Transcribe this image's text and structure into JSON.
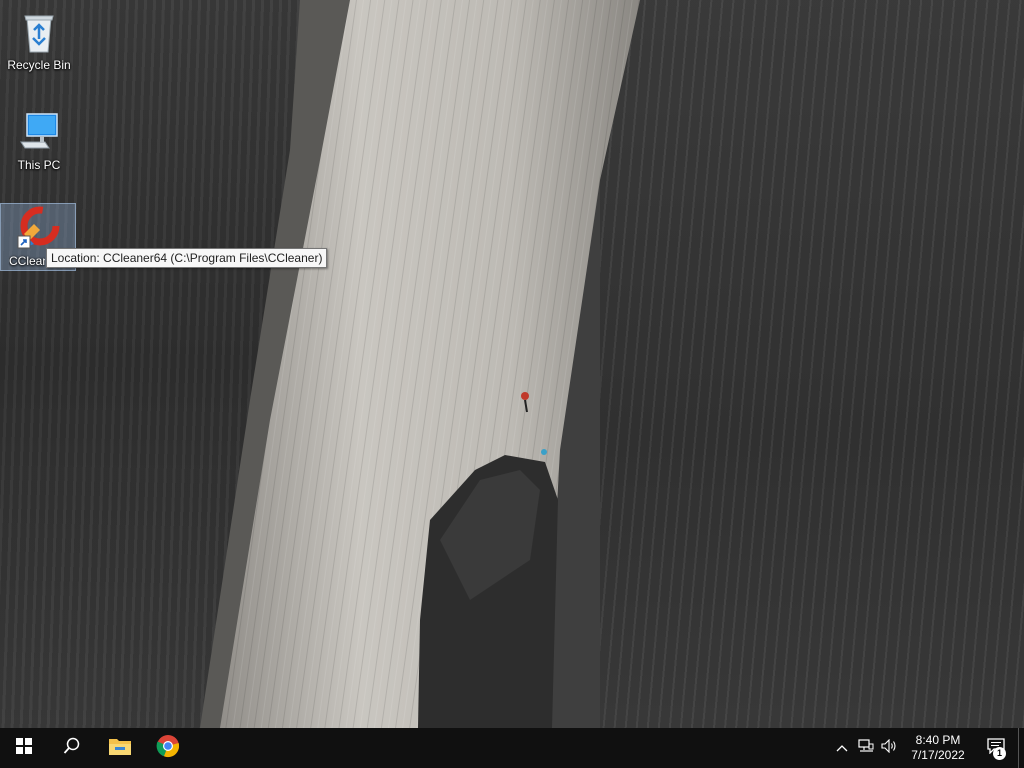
{
  "desktop": {
    "icons": [
      {
        "label": "Recycle Bin",
        "icon": "recycle-bin-icon"
      },
      {
        "label": "This PC",
        "icon": "this-pc-icon"
      },
      {
        "label": "CCleaner",
        "icon": "ccleaner-icon",
        "shortcut": true,
        "selected": true
      }
    ],
    "tooltip": "Location: CCleaner64 (C:\\Program Files\\CCleaner)"
  },
  "taskbar": {
    "start": "windows-start-icon",
    "search": "search-icon",
    "pinned": [
      "file-explorer-icon",
      "chrome-icon"
    ],
    "tray": {
      "icons": [
        "chevron-up-icon",
        "network-icon",
        "volume-icon"
      ],
      "time": "8:40 PM",
      "date": "7/17/2022",
      "notification_count": "1"
    }
  },
  "colors": {
    "taskbar": "#101010",
    "selection": "#96b4dc"
  }
}
